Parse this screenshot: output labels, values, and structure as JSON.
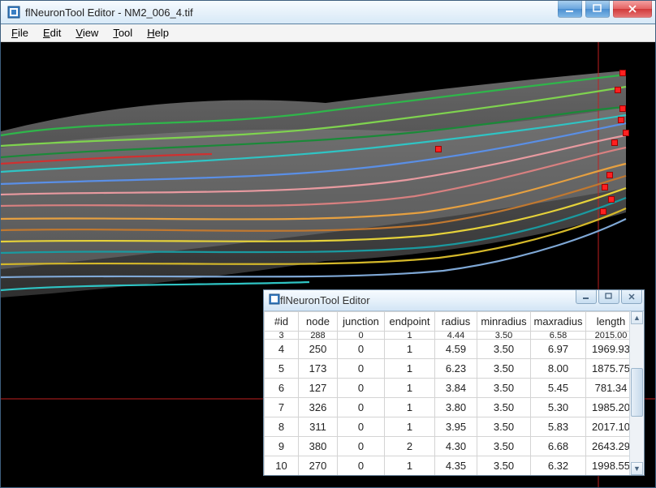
{
  "window": {
    "title": "flNeuronTool Editor - NM2_006_4.tif",
    "appicon_color": "#3a7fc4"
  },
  "menubar": {
    "items": [
      "File",
      "Edit",
      "View",
      "Tool",
      "Help"
    ]
  },
  "subwindow": {
    "title": "flNeuronTool Editor"
  },
  "table": {
    "headers": [
      "#id",
      "node",
      "junction",
      "endpoint",
      "radius",
      "minradius",
      "maxradius",
      "length"
    ],
    "rows": [
      {
        "id": "3",
        "node": "288",
        "junction": "0",
        "endpoint": "1",
        "radius": "4.44",
        "minradius": "3.50",
        "maxradius": "6.58",
        "length": "2015.00"
      },
      {
        "id": "4",
        "node": "250",
        "junction": "0",
        "endpoint": "1",
        "radius": "4.59",
        "minradius": "3.50",
        "maxradius": "6.97",
        "length": "1969.93"
      },
      {
        "id": "5",
        "node": "173",
        "junction": "0",
        "endpoint": "1",
        "radius": "6.23",
        "minradius": "3.50",
        "maxradius": "8.00",
        "length": "1875.75"
      },
      {
        "id": "6",
        "node": "127",
        "junction": "0",
        "endpoint": "1",
        "radius": "3.84",
        "minradius": "3.50",
        "maxradius": "5.45",
        "length": "781.34"
      },
      {
        "id": "7",
        "node": "326",
        "junction": "0",
        "endpoint": "1",
        "radius": "3.80",
        "minradius": "3.50",
        "maxradius": "5.30",
        "length": "1985.20"
      },
      {
        "id": "8",
        "node": "311",
        "junction": "0",
        "endpoint": "1",
        "radius": "3.95",
        "minradius": "3.50",
        "maxradius": "5.83",
        "length": "2017.10"
      },
      {
        "id": "9",
        "node": "380",
        "junction": "0",
        "endpoint": "2",
        "radius": "4.30",
        "minradius": "3.50",
        "maxradius": "6.68",
        "length": "2643.29"
      },
      {
        "id": "10",
        "node": "270",
        "junction": "0",
        "endpoint": "1",
        "radius": "4.35",
        "minradius": "3.50",
        "maxradius": "6.32",
        "length": "1998.55"
      }
    ]
  },
  "traces": {
    "colors": {
      "green": "#2fb64a",
      "darkgreen": "#1a8a38",
      "lime": "#7fd34f",
      "cyan": "#2fc4c4",
      "teal": "#1a9aa0",
      "blue": "#5a8fe6",
      "steel": "#7fa8d6",
      "pink": "#e89aa0",
      "salmon": "#d88080",
      "orange": "#e6a040",
      "brown": "#c07830",
      "yellow": "#e6d23a",
      "gold": "#d4b82a",
      "red": "#d03030",
      "gray": "#a0a0a0"
    }
  }
}
